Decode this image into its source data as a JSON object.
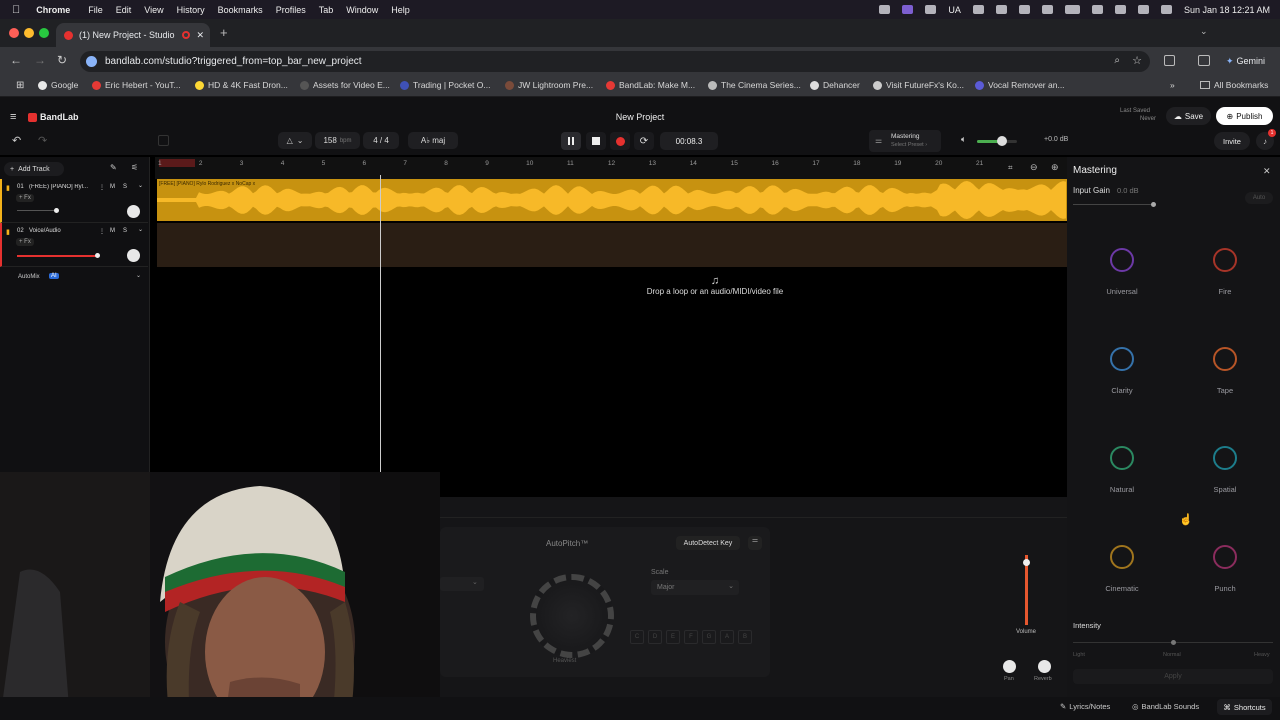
{
  "menubar": {
    "app": "Chrome",
    "items": [
      "File",
      "Edit",
      "View",
      "History",
      "Bookmarks",
      "Profiles",
      "Tab",
      "Window",
      "Help"
    ],
    "lang": "UA",
    "clock": "Sun Jan 18  12:21 AM"
  },
  "browser": {
    "tab_title": "(1) New Project - Studio",
    "url": "bandlab.com/studio?triggered_from=top_bar_new_project",
    "gemini": "Gemini",
    "bookmarks": [
      "Google",
      "Eric Hebert - YouT...",
      "HD & 4K Fast Dron...",
      "Assets for Video E...",
      "Trading | Pocket O...",
      "JW Lightroom Pre...",
      "BandLab: Make M...",
      "The Cinema Series...",
      "Dehancer",
      "Visit FutureFx's Ko...",
      "Vocal Remover an..."
    ],
    "all_bookmarks": "All Bookmarks",
    "bookmark_colors": [
      "#e8e8e8",
      "#e53935",
      "#fdd835",
      "#888",
      "#3f51b5",
      "#7a4b3a",
      "#e53935",
      "#bbb",
      "#ddd",
      "#ccc",
      "#5b5bd6"
    ]
  },
  "bandlab": {
    "logo": "BandLab",
    "project_title": "New Project",
    "last_saved_label": "Last Saved",
    "last_saved_value": "Never",
    "save": "Save",
    "publish": "Publish",
    "invite": "Invite",
    "notif_count": "1",
    "tempo": "158",
    "tempo_unit": "bpm",
    "time_sig": "4 / 4",
    "key": "A♭ maj",
    "time": "00:08.3",
    "mastering_label": "Mastering",
    "mastering_sub": "Select Preset ›",
    "master_db": "+0.0 dB",
    "master_volume_level": 0.62,
    "add_track": "Add Track",
    "tracks": [
      {
        "num": "01",
        "name": "(FREE) [PIANO] Ryl...",
        "fx": "+ Fx",
        "m": "M",
        "s": "S"
      },
      {
        "num": "02",
        "name": "Voice/Audio",
        "fx": "+ Fx",
        "m": "M",
        "s": "S"
      }
    ],
    "automix": "AutoMix",
    "automix_badge": "AI",
    "ruler": [
      "1",
      "2",
      "3",
      "4",
      "5",
      "6",
      "7",
      "8",
      "9",
      "10",
      "11",
      "12",
      "13",
      "14",
      "15",
      "16",
      "17",
      "18",
      "19",
      "20",
      "21"
    ],
    "region_name": "[FREE] [PIANO] Rylo Rodriguez x NoCap x",
    "drop_hint": "Drop a loop or an audio/MIDI/video file",
    "autopitch": {
      "title": "AutoPitch™",
      "detect": "AutoDetect Key",
      "scale_label": "Scale",
      "scale_value": "Major",
      "knob_label": "Heaviest",
      "notes": [
        "C",
        "D",
        "E",
        "F",
        "G",
        "A",
        "B"
      ]
    },
    "mixer": {
      "volume": "Volume",
      "pan": "Pan",
      "reverb": "Reverb"
    },
    "panel": {
      "title": "Mastering",
      "input_gain_label": "Input Gain",
      "input_gain_value": "0.0 dB",
      "auto": "Auto",
      "presets": [
        {
          "name": "Universal",
          "icon": "music-note-icon",
          "color": "#7b3fbf"
        },
        {
          "name": "Fire",
          "icon": "flame-icon",
          "color": "#c0392b"
        },
        {
          "name": "Clarity",
          "icon": "diamond-icon",
          "color": "#3b82c4"
        },
        {
          "name": "Tape",
          "icon": "cassette-icon",
          "color": "#d4602a"
        },
        {
          "name": "Natural",
          "icon": "lotus-icon",
          "color": "#2f9e6f"
        },
        {
          "name": "Spatial",
          "icon": "spiral-icon",
          "color": "#1e8fa0"
        },
        {
          "name": "Cinematic",
          "icon": "film-reel-icon",
          "color": "#b8861e"
        },
        {
          "name": "Punch",
          "icon": "burst-icon",
          "color": "#a0306a"
        }
      ],
      "intensity_label": "Intensity",
      "intensity_ticks": [
        "Light",
        "Normal",
        "Heavy"
      ],
      "apply": "Apply"
    },
    "footer": {
      "lyrics": "Lyrics/Notes",
      "sounds": "BandLab Sounds",
      "shortcuts": "Shortcuts"
    },
    "accent": "#e5312f",
    "region_color": "#f4b21a"
  }
}
